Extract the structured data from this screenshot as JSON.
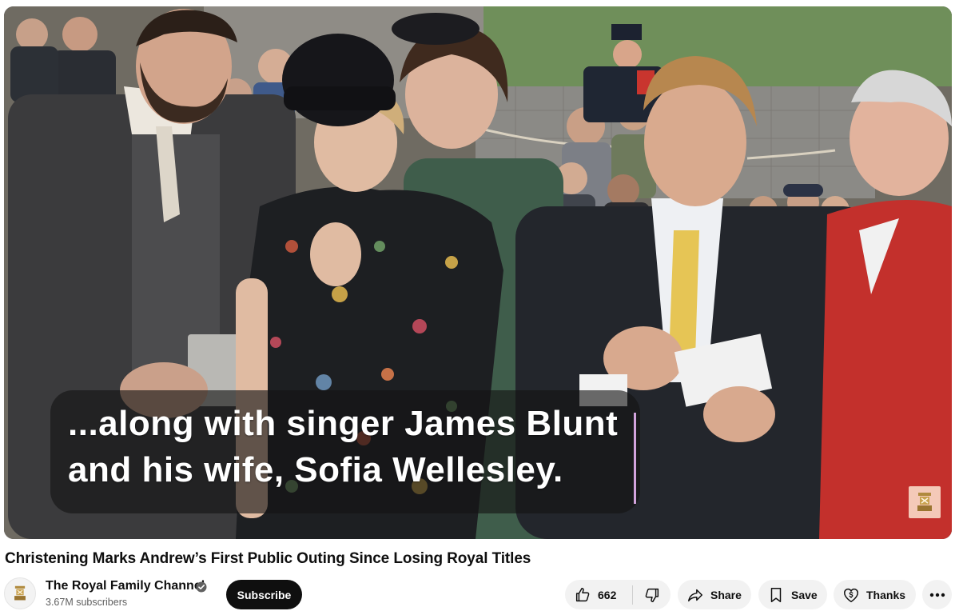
{
  "video": {
    "caption_line1": "...along with singer James Blunt",
    "caption_line2": "and his wife, Sofia Wellesley.",
    "watermark_icon": "royal-crest-icon"
  },
  "title": "Christening Marks Andrew’s First Public Outing Since Losing Royal Titles",
  "channel": {
    "name": "The Royal Family Channel",
    "verified": true,
    "subscribers": "3.67M subscribers",
    "avatar_icon": "royal-crest-icon"
  },
  "actions": {
    "subscribe_label": "Subscribe",
    "like_count": "662",
    "share_label": "Share",
    "save_label": "Save",
    "thanks_label": "Thanks"
  },
  "colors": {
    "subscribe_bg": "#0f0f0f",
    "pill_bg": "#f2f2f2",
    "secondary_text": "#606060"
  }
}
